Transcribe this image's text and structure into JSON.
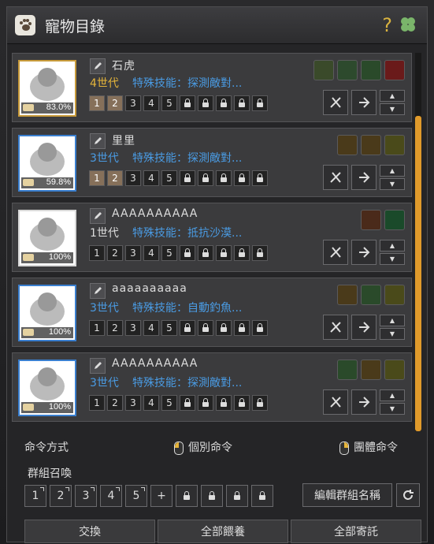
{
  "window": {
    "title": "寵物目錄",
    "help": "?"
  },
  "pets": [
    {
      "name": "石虎",
      "generation": "4世代",
      "gen_color": "gold",
      "skill": "特殊技能：探測敵對...",
      "hunger": "83.0%",
      "frame": "gold",
      "active_slots": 2,
      "skills": [
        "#3a4a2a",
        "#2d4a2d",
        "#2a4a2a",
        "#6a1a1a"
      ]
    },
    {
      "name": "里里",
      "generation": "3世代",
      "gen_color": "blue",
      "skill": "特殊技能：探測敵對...",
      "hunger": "59.8%",
      "frame": "blue",
      "active_slots": 2,
      "skills": [
        "#4a3a1a",
        "#4a3a1a",
        "#4a4a1a"
      ]
    },
    {
      "name": "AAAAAAAAAA",
      "generation": "1世代",
      "gen_color": "white",
      "skill": "特殊技能：抵抗沙漠...",
      "hunger": "100%",
      "frame": "white",
      "active_slots": 0,
      "skills": [
        "#4a2a1a",
        "#1a4a2a"
      ]
    },
    {
      "name": "aaaaaaaaaa",
      "generation": "3世代",
      "gen_color": "blue",
      "skill": "特殊技能：自動釣魚...",
      "hunger": "100%",
      "frame": "blue",
      "active_slots": 0,
      "skills": [
        "#4a3a1a",
        "#2a4a2a",
        "#4a4a1a"
      ]
    },
    {
      "name": "AAAAAAAAAA",
      "generation": "3世代",
      "gen_color": "blue",
      "skill": "特殊技能：探測敵對...",
      "hunger": "100%",
      "frame": "blue",
      "active_slots": 0,
      "skills": [
        "#2a4a2a",
        "#4a3a1a",
        "#4a4a1a"
      ]
    }
  ],
  "slot_numbers": [
    "1",
    "2",
    "3",
    "4",
    "5"
  ],
  "commands": {
    "label": "命令方式",
    "individual": "個別命令",
    "group": "團體命令"
  },
  "group_summon": {
    "label": "群組召喚",
    "buttons": [
      "1",
      "2",
      "3",
      "4",
      "5"
    ],
    "add": "+",
    "edit_name": "編輯群組名稱"
  },
  "bottom": {
    "exchange": "交換",
    "feed_all": "全部餵養",
    "store_all": "全部寄託"
  },
  "colors": {
    "accent": "#e09a2b",
    "gold": "#e5b43a",
    "blue": "#4a9be3"
  }
}
